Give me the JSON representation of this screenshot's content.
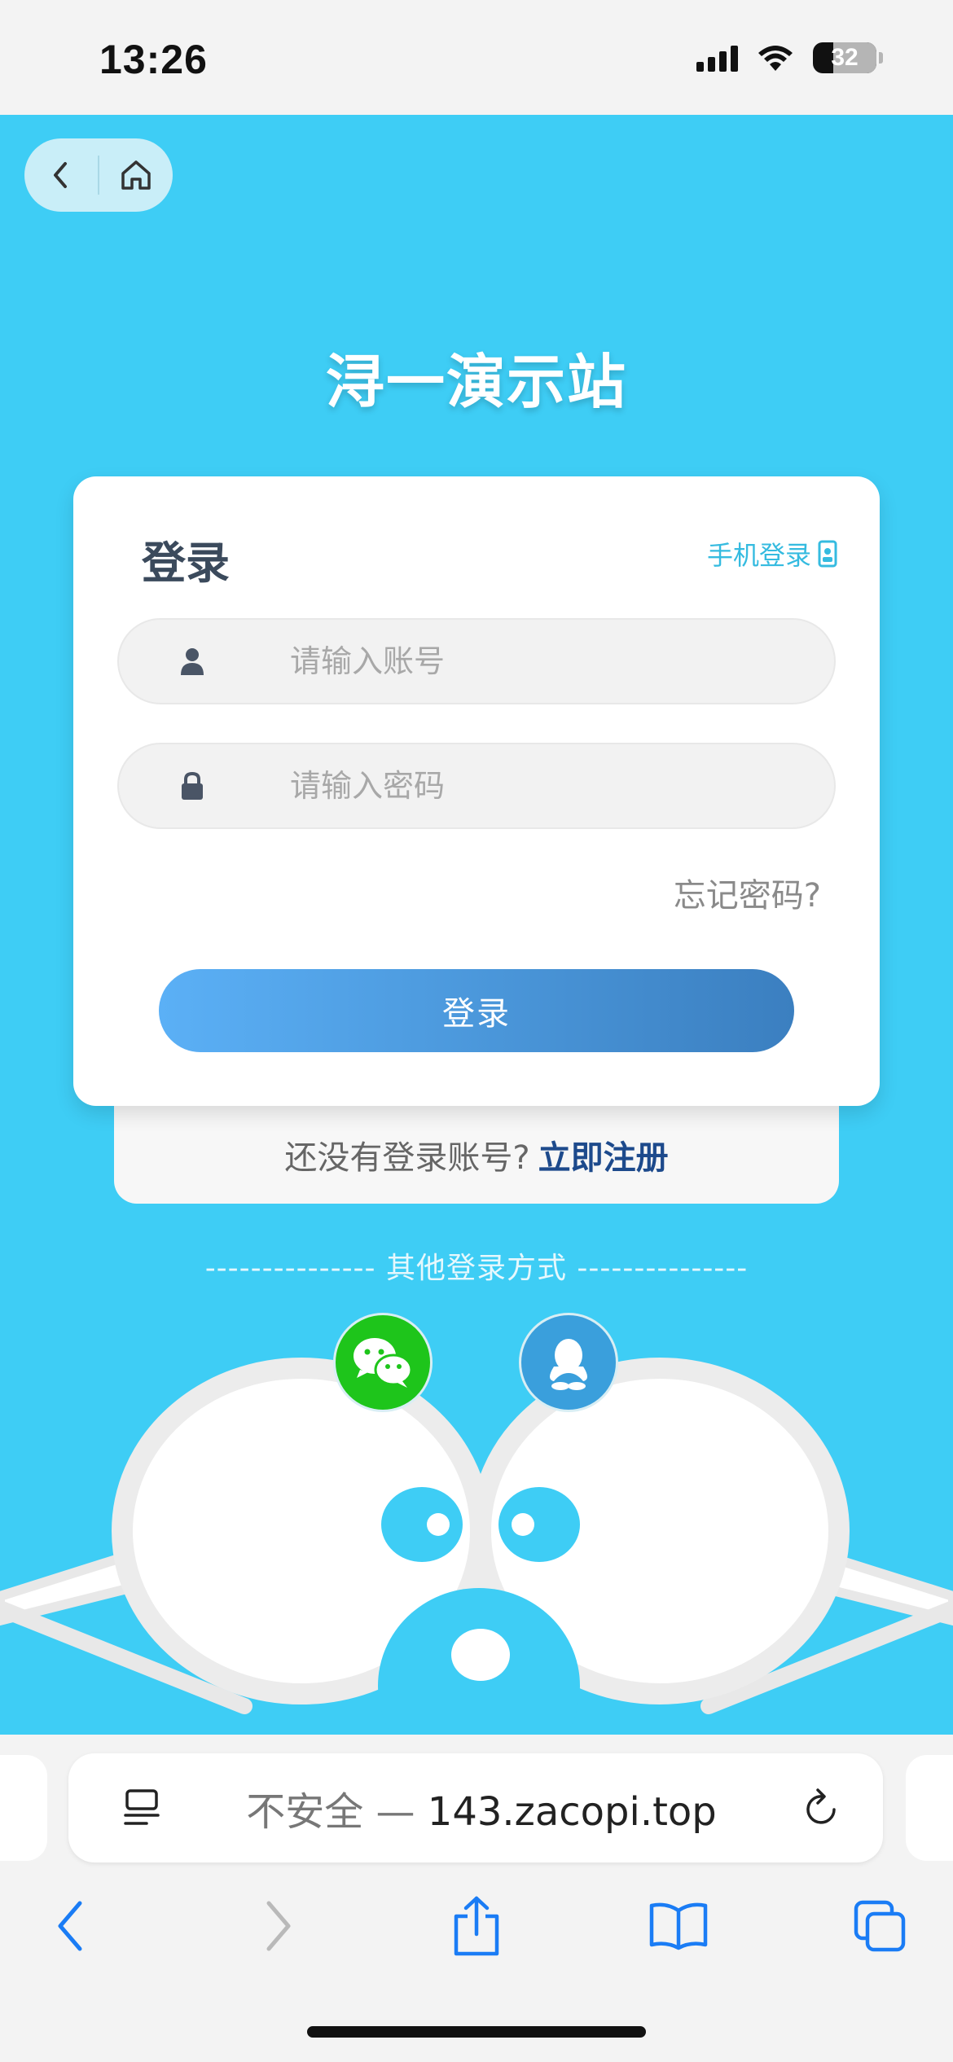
{
  "status_bar": {
    "time": "13:26",
    "battery": "32",
    "battery_level_fraction": 0.32
  },
  "nav": {
    "back_icon": "chevron-left-icon",
    "home_icon": "home-icon"
  },
  "site_title": "浔一演示站",
  "login_card": {
    "title": "登录",
    "phone_login_label": "手机登录",
    "phone_icon": "phone-icon",
    "account_placeholder": "请输入账号",
    "password_placeholder": "请输入密码",
    "forgot_label": "忘记密码?",
    "login_button": "登录"
  },
  "register": {
    "prompt": "还没有登录账号?",
    "link": "立即注册"
  },
  "other_ways": "--------------- 其他登录方式 ---------------",
  "social": [
    {
      "name": "wechat",
      "icon": "wechat-icon",
      "color": "#1ec51b"
    },
    {
      "name": "qq",
      "icon": "qq-icon",
      "color": "#3a9fdc"
    }
  ],
  "browser": {
    "url_warning": "不安全 —",
    "url_host": "143.zacopi.top",
    "accent_color": "#1a7cf5"
  },
  "colors": {
    "background": "#3ecdf5",
    "login_button_start": "#5bb0f6",
    "login_button_end": "#3b7fc0",
    "register_link": "#1d4a8c"
  }
}
